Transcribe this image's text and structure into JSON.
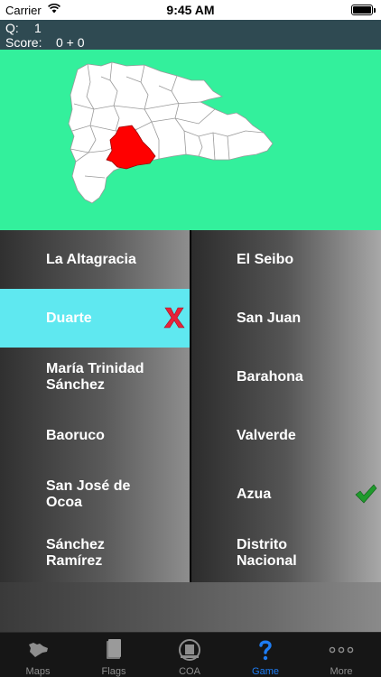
{
  "status_bar": {
    "carrier": "Carrier",
    "time": "9:45 AM",
    "battery_level": 1.0
  },
  "info": {
    "q_label": "Q:",
    "q_value": "1",
    "score_label": "Score:",
    "score_value": "0 + 0"
  },
  "map": {
    "background": "#33f09c",
    "highlight_color": "#ff0000",
    "province_fill": "#ffffff"
  },
  "answers": {
    "left": [
      {
        "label": "La Altagracia",
        "state": "normal"
      },
      {
        "label": "Duarte",
        "state": "wrong"
      },
      {
        "label": "María Trinidad Sánchez",
        "state": "normal"
      },
      {
        "label": "Baoruco",
        "state": "normal"
      },
      {
        "label": "San José de Ocoa",
        "state": "normal"
      },
      {
        "label": "Sánchez Ramírez",
        "state": "normal"
      }
    ],
    "right": [
      {
        "label": "El Seibo",
        "state": "normal"
      },
      {
        "label": "San Juan",
        "state": "normal"
      },
      {
        "label": "Barahona",
        "state": "normal"
      },
      {
        "label": "Valverde",
        "state": "normal"
      },
      {
        "label": "Azua",
        "state": "correct"
      },
      {
        "label": "Distrito Nacional",
        "state": "normal"
      }
    ],
    "wrong_mark_icon": "x-mark-icon",
    "correct_mark_icon": "checkmark-icon",
    "selected_color": "#5fe8f0"
  },
  "tabs": [
    {
      "label": "Maps",
      "icon": "map-icon",
      "active": false
    },
    {
      "label": "Flags",
      "icon": "flag-icon",
      "active": false
    },
    {
      "label": "COA",
      "icon": "coat-of-arms-icon",
      "active": false
    },
    {
      "label": "Game",
      "icon": "question-mark-icon",
      "active": true
    },
    {
      "label": "More",
      "icon": "more-dots-icon",
      "active": false
    }
  ],
  "colors": {
    "active_tab": "#1e7cf2",
    "inactive_tab": "#8e8e8e"
  }
}
